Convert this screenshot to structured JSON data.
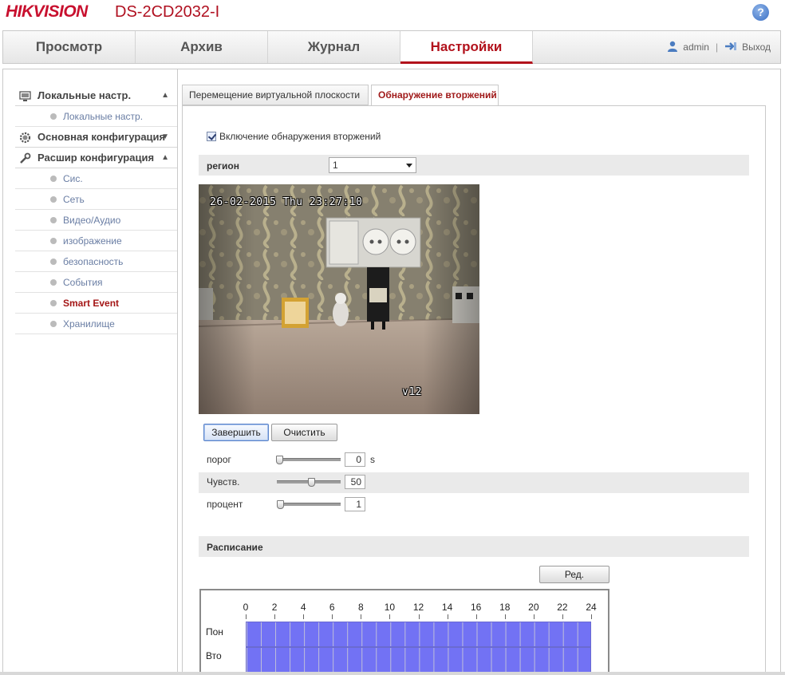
{
  "header": {
    "logo": "HIKVISION",
    "model": "DS-2CD2032-I",
    "help_icon": "help-icon"
  },
  "nav": {
    "items": [
      {
        "label": "Просмотр"
      },
      {
        "label": "Архив"
      },
      {
        "label": "Журнал"
      },
      {
        "label": "Настройки",
        "active": true
      }
    ],
    "user": "admin",
    "separator": "|",
    "logout": "Выход"
  },
  "sidebar": {
    "groups": [
      {
        "label": "Локальные настр.",
        "icon": "monitor-icon",
        "chevron": "^",
        "items": [
          {
            "label": "Локальные настр."
          }
        ]
      },
      {
        "label": "Основная конфигурация",
        "icon": "gear-icon",
        "chevron": "v",
        "items": []
      },
      {
        "label": "Расшир конфигурация",
        "icon": "wrench-icon",
        "chevron": "^",
        "items": [
          {
            "label": "Сис."
          },
          {
            "label": "Сеть"
          },
          {
            "label": "Видео/Аудио"
          },
          {
            "label": "изображение"
          },
          {
            "label": "безопасность"
          },
          {
            "label": "События"
          },
          {
            "label": "Smart Event",
            "active": true
          },
          {
            "label": "Хранилище"
          }
        ]
      }
    ]
  },
  "tabs": [
    {
      "label": "Перемещение виртуальной плоскости"
    },
    {
      "label": "Обнаружение вторжений",
      "active": true
    }
  ],
  "form": {
    "enable_label": "Включение обнаружения вторжений",
    "enable_checked": true,
    "region_label": "регион",
    "region_value": "1",
    "video_osd_time": "26-02-2015 Thu 23:27:10",
    "video_osd_name": "v12",
    "finish_button": "Завершить",
    "clear_button": "Очистить",
    "threshold_label": "порог",
    "threshold_value": "0",
    "threshold_unit": "s",
    "threshold_level": 0,
    "sensitivity_label": "Чувств.",
    "sensitivity_value": "50",
    "sensitivity_level": 0.5,
    "percent_label": "процент",
    "percent_value": "1",
    "percent_level": 0.01
  },
  "schedule": {
    "title": "Расписание",
    "edit_button": "Ред.",
    "hours": [
      "0",
      "2",
      "4",
      "6",
      "8",
      "10",
      "12",
      "14",
      "16",
      "18",
      "20",
      "22",
      "24"
    ],
    "days": [
      "Пон",
      "Вто"
    ],
    "fill_color": "#7272f4"
  }
}
